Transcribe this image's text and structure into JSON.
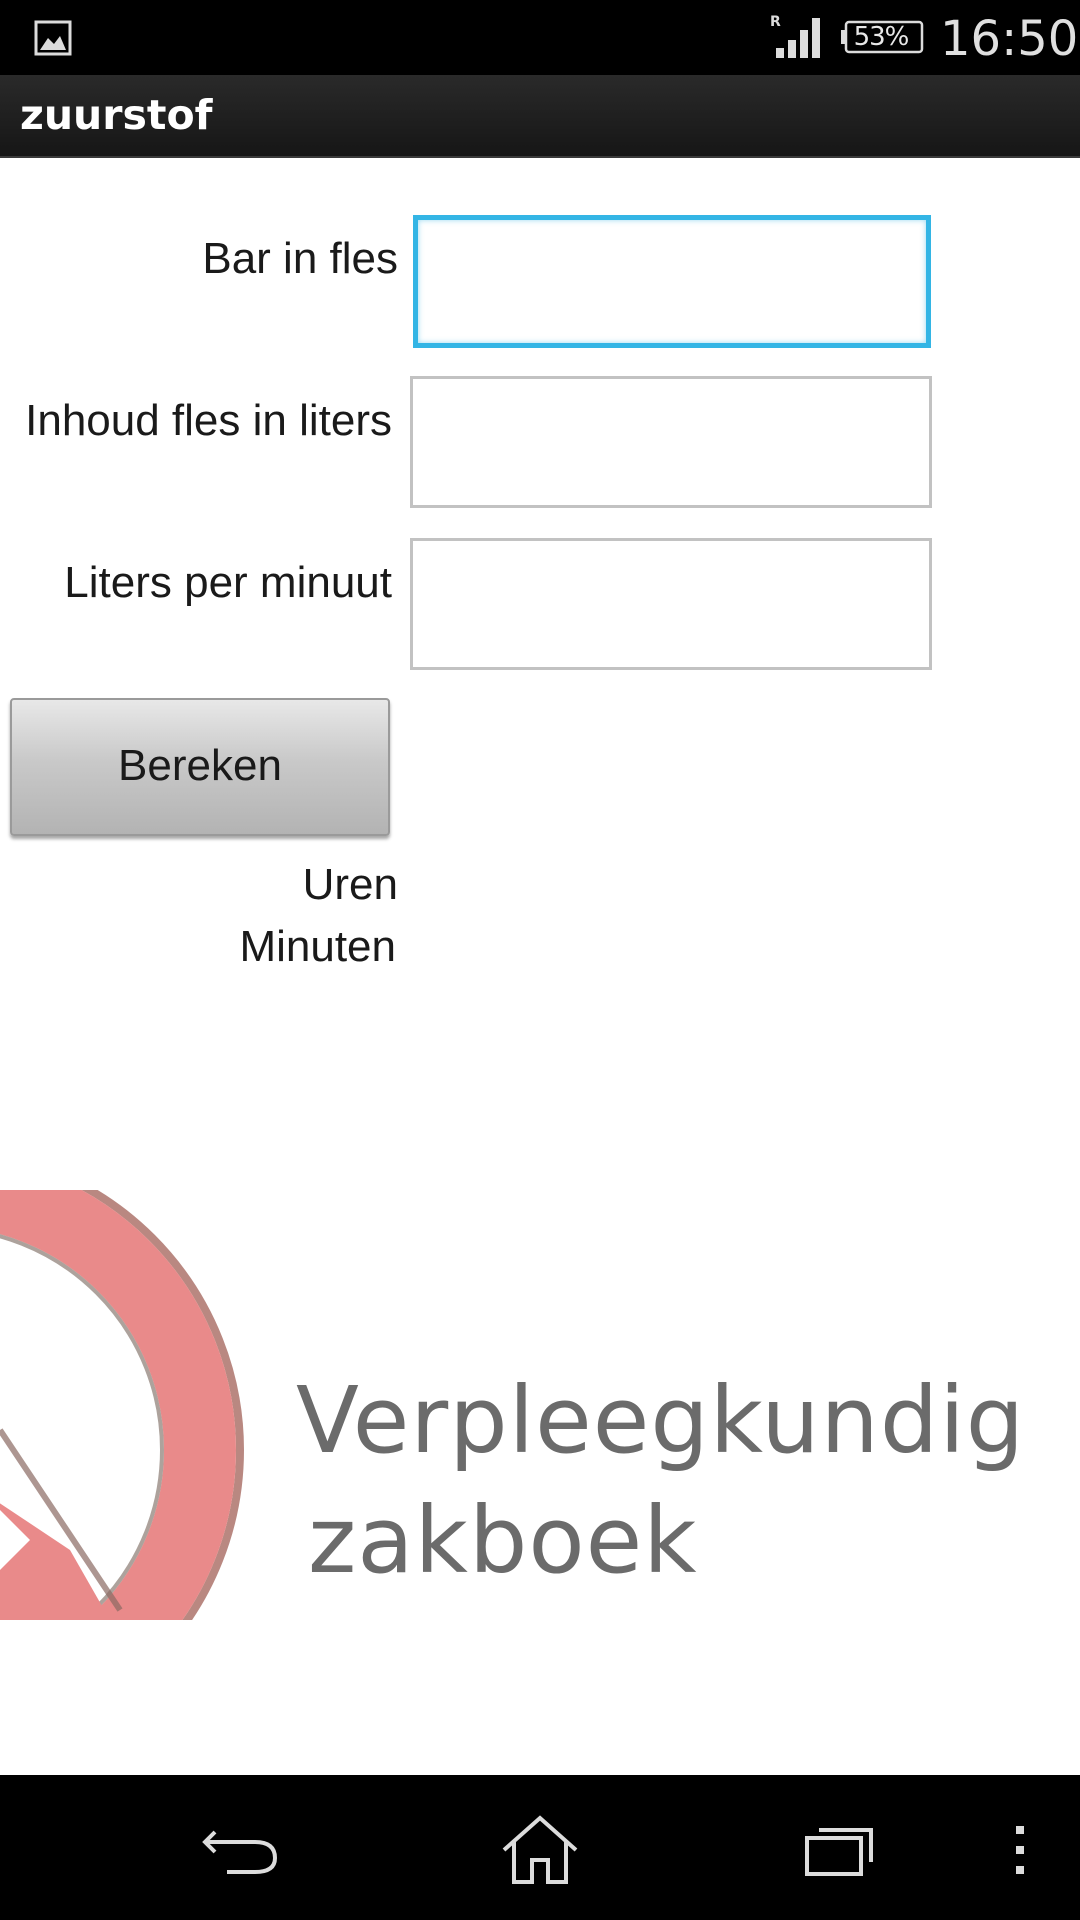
{
  "status_bar": {
    "battery": "53%",
    "time": "16:50",
    "gallery_icon": "gallery-icon",
    "signal_icon": "signal-icon",
    "roaming_indicator": "R"
  },
  "action_bar": {
    "title": "zuurstof"
  },
  "form": {
    "bar_label": "Bar in fles",
    "bar_value": "",
    "inhoud_label": "Inhoud fles in liters",
    "inhoud_value": "",
    "liters_label": "Liters per minuut",
    "liters_value": "",
    "calculate_button": "Bereken"
  },
  "results": {
    "uren_label": "Uren",
    "minuten_label": "Minuten"
  },
  "watermark": {
    "line1": "Verpleegkundig",
    "line2": "zakboek"
  },
  "nav_bar": {
    "back_icon": "back-icon",
    "home_icon": "home-icon",
    "recent_icon": "recent-apps-icon",
    "menu_icon": "overflow-menu-icon"
  },
  "colors": {
    "focus_accent": "#33b5e5",
    "watermark_red": "#e98a8a",
    "watermark_text": "#6b6b6b"
  }
}
